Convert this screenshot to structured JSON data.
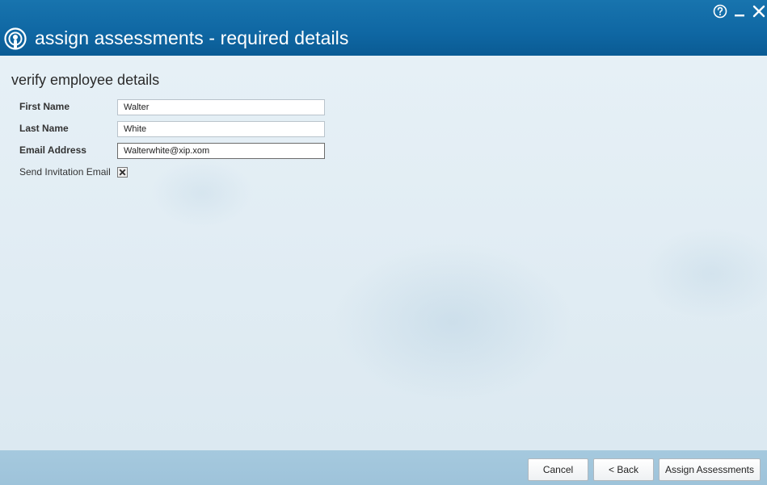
{
  "window": {
    "title": "assign assessments - required details",
    "app_icon": "podcast-icon",
    "controls": {
      "help_icon": "help-circle-icon",
      "minimize_icon": "minimize-icon",
      "close_icon": "close-icon"
    }
  },
  "form": {
    "section_title": "verify employee details",
    "first_name": {
      "label": "First Name",
      "value": "Walter"
    },
    "last_name": {
      "label": "Last Name",
      "value": "White"
    },
    "email": {
      "label": "Email Address",
      "value": "Walterwhite@xip.xom"
    },
    "send_invitation": {
      "label": "Send Invitation Email",
      "checked": true
    }
  },
  "footer": {
    "cancel_label": "Cancel",
    "back_label": "< Back",
    "assign_label": "Assign Assessments"
  },
  "colors": {
    "titlebar": "#0f67a3",
    "content_bg": "#e3eef5",
    "footer_bg": "#a5c9de"
  }
}
